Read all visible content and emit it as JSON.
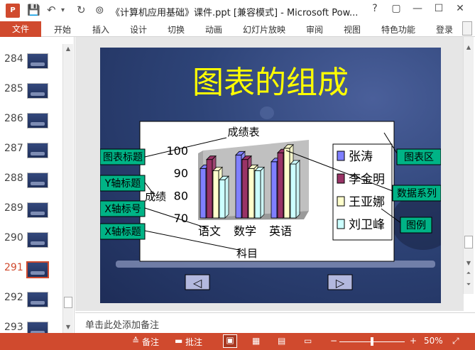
{
  "app": {
    "title": "《计算机应用基础》课件.ppt [兼容模式] - Microsoft Pow...",
    "icon_label": "P",
    "help": "?",
    "restore": "▢",
    "minimize": "—",
    "maximize": "☐",
    "close": "✕"
  },
  "ribbon": {
    "file": "文件",
    "tabs": [
      "开始",
      "插入",
      "设计",
      "切换",
      "动画",
      "幻灯片放映",
      "审阅",
      "视图",
      "特色功能",
      "登录"
    ]
  },
  "thumbnails": {
    "items": [
      {
        "num": "284"
      },
      {
        "num": "285"
      },
      {
        "num": "286"
      },
      {
        "num": "287"
      },
      {
        "num": "288"
      },
      {
        "num": "289"
      },
      {
        "num": "290"
      },
      {
        "num": "291"
      },
      {
        "num": "292"
      },
      {
        "num": "293"
      }
    ],
    "selected": "291"
  },
  "slide": {
    "title": "图表的组成",
    "chart_data": {
      "type": "bar",
      "title": "成绩表",
      "xlabel": "科目",
      "ylabel": "成绩",
      "categories": [
        "语文",
        "数学",
        "英语"
      ],
      "yticks": [
        "100",
        "90",
        "80",
        "70"
      ],
      "ylim": [
        70,
        100
      ],
      "series": [
        {
          "name": "张涛",
          "color": "#7f7fff",
          "values": [
            92,
            98,
            95
          ]
        },
        {
          "name": "李金明",
          "color": "#993366",
          "values": [
            96,
            96,
            99
          ]
        },
        {
          "name": "王亚娜",
          "color": "#ffffcc",
          "values": [
            91,
            92,
            101
          ]
        },
        {
          "name": "刘卫峰",
          "color": "#ccffff",
          "values": [
            87,
            91,
            94
          ]
        }
      ],
      "legend_position": "right"
    },
    "callouts": {
      "chart_title": "图表标题",
      "y_axis_title": "Y轴标题",
      "x_axis_label": "X轴标号",
      "x_axis_title": "X轴标题",
      "chart_area": "图表区",
      "data_series": "数据系列",
      "legend": "图例"
    },
    "nav": {
      "prev": "◁",
      "next": "▷"
    }
  },
  "notes": {
    "placeholder": "单击此处添加备注"
  },
  "status": {
    "notes_label": "备注",
    "comments_label": "批注",
    "zoom_minus": "−",
    "zoom_plus": "+",
    "zoom_value": "50%",
    "zoom_fraction": 0.5
  },
  "colors": {
    "accent": "#d04a2e",
    "callout_bg": "#00b386",
    "title_yellow": "#ffff00"
  }
}
